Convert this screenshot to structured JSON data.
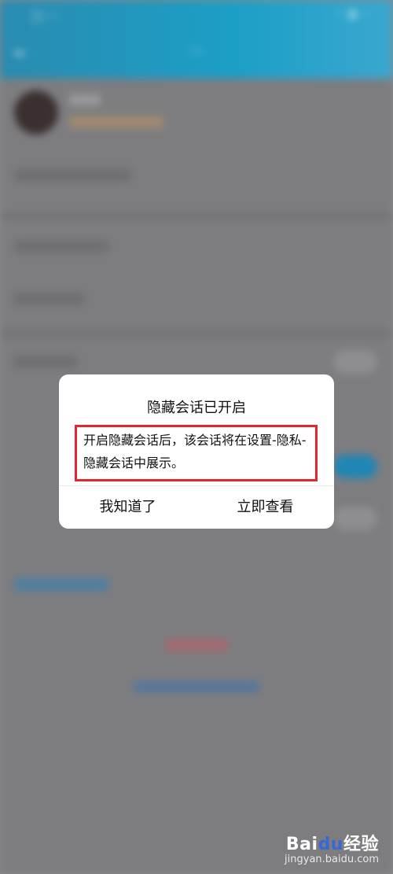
{
  "background": {
    "status_left": "▢ ···",
    "status_right": "··· ▮ ···",
    "page_title": "···",
    "back_icon": "back-arrow-icon"
  },
  "dialog": {
    "title": "隐藏会话已开启",
    "message": "开启隐藏会话后，该会话将在设置-隐私-隐藏会话中展示。",
    "buttons": {
      "dismiss": "我知道了",
      "view_now": "立即查看"
    },
    "highlight_color": "#e0262f"
  },
  "watermark": {
    "logo_text": "Bai",
    "logo_paw": "du",
    "logo_suffix": "经验",
    "url": "jingyan.baidu.com"
  }
}
